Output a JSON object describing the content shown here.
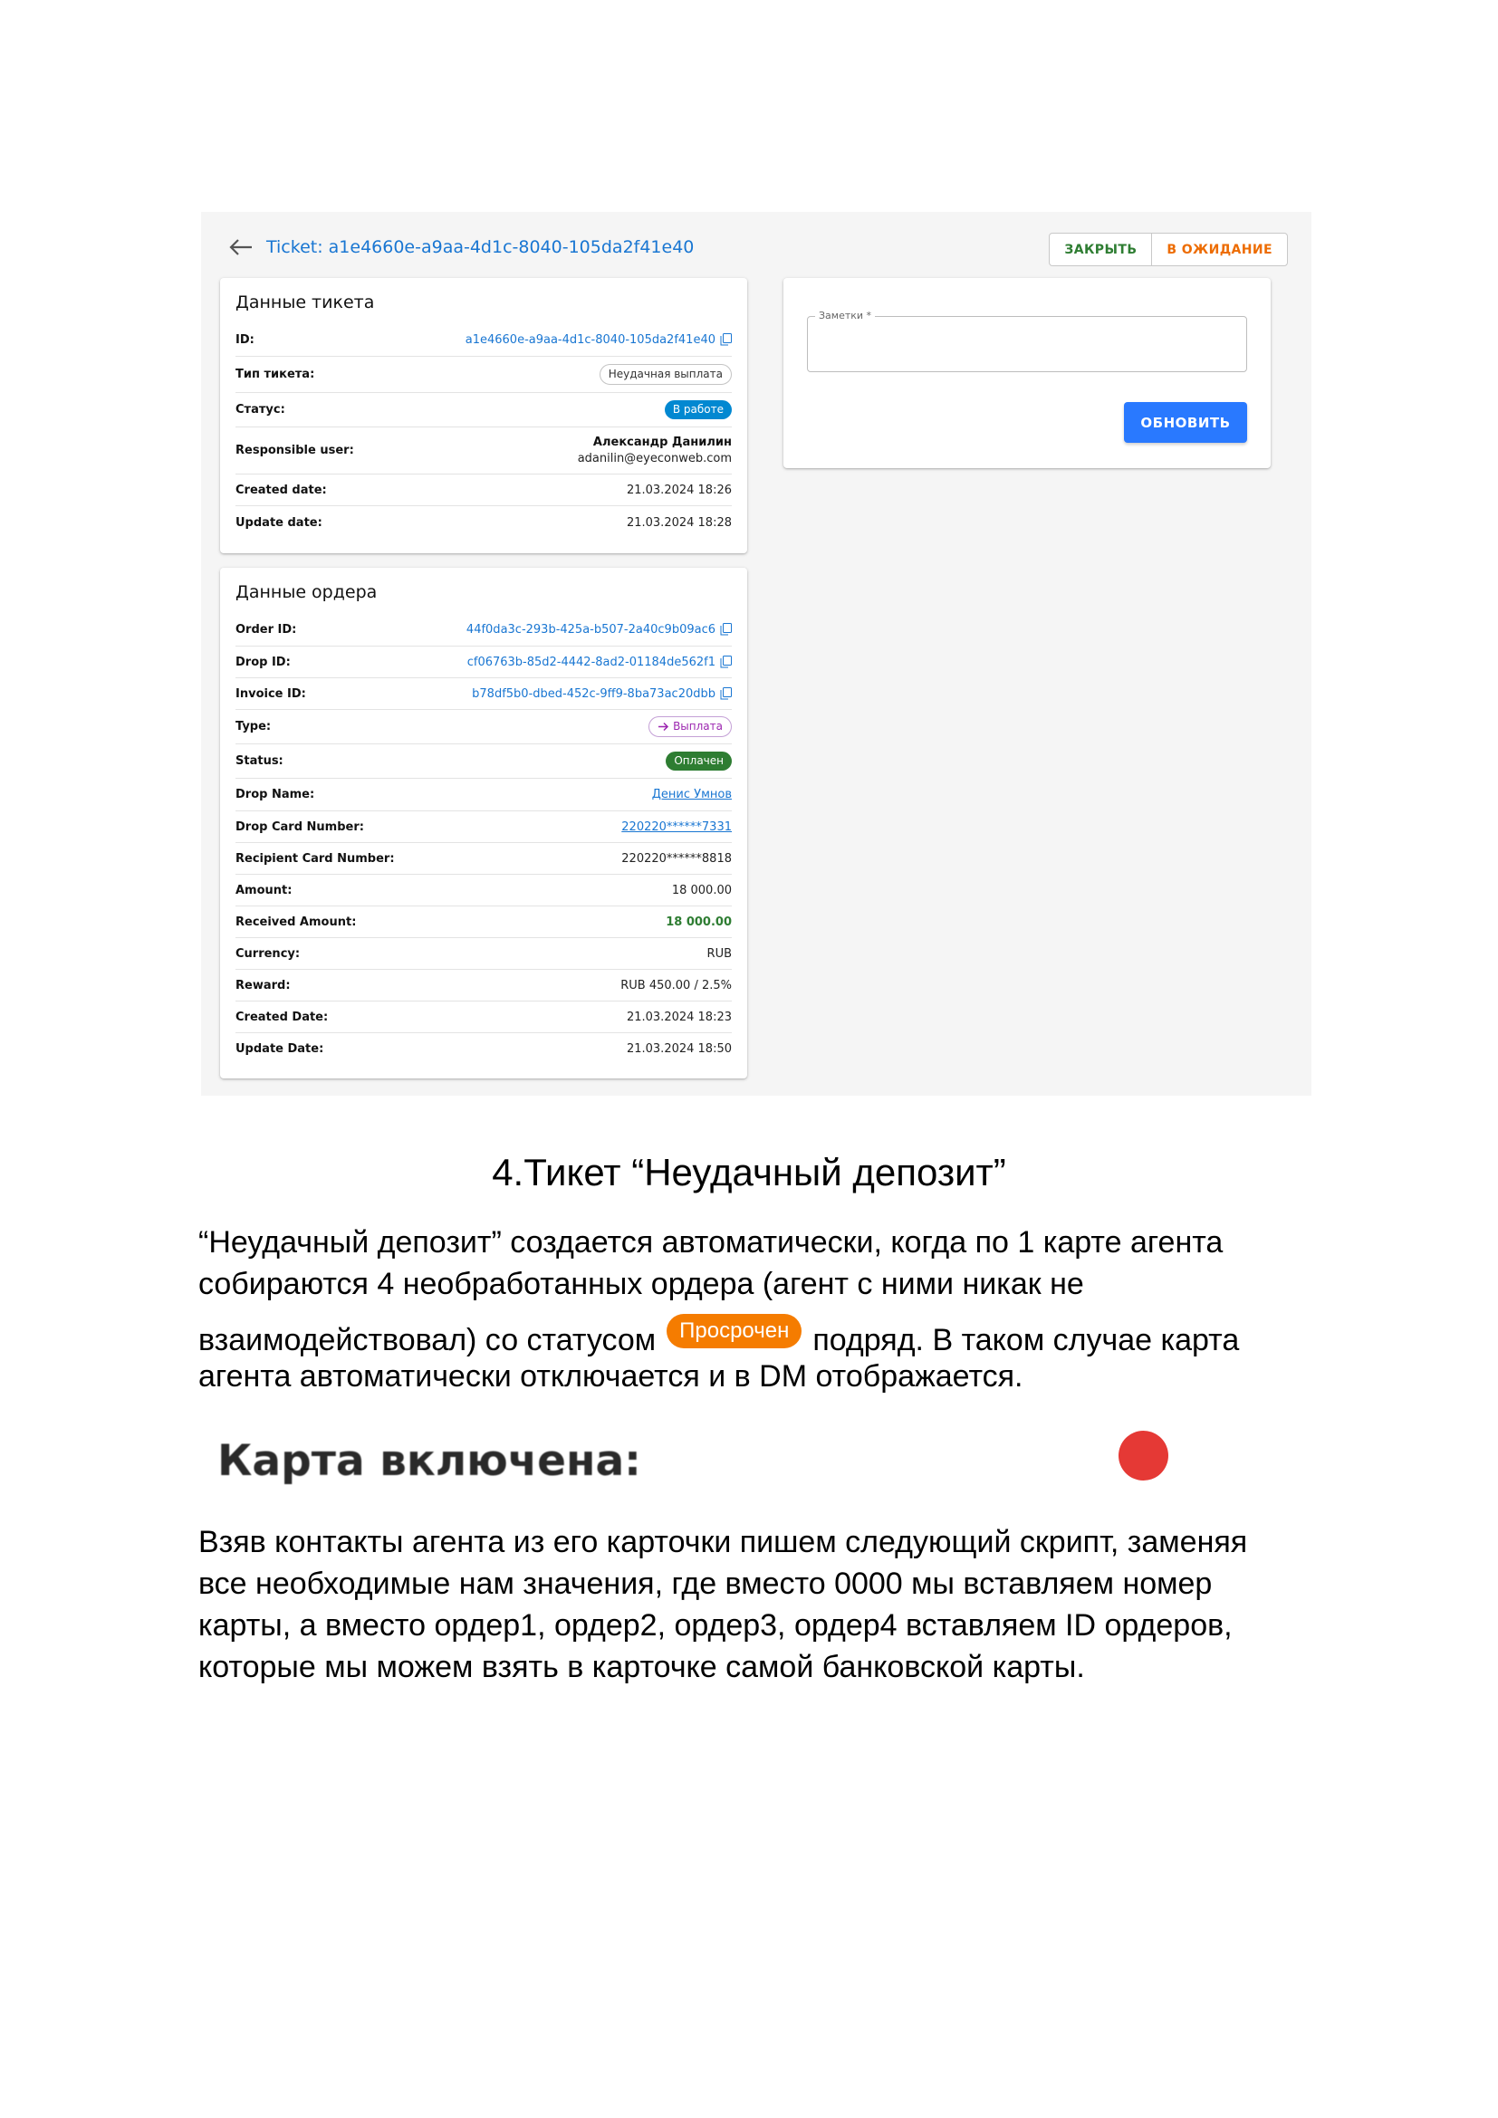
{
  "screenshot": {
    "ticket_title": "Ticket: a1e4660e-a9aa-4d1c-8040-105da2f41e40",
    "buttons": {
      "close": "ЗАКРЫТЬ",
      "waiting": "В ОЖИДАНИЕ"
    },
    "ticket_card": {
      "title": "Данные тикета",
      "rows": [
        {
          "key": "ID:",
          "value": "a1e4660e-a9aa-4d1c-8040-105da2f41e40"
        },
        {
          "key": "Тип тикета:",
          "value": "Неудачная выплата"
        },
        {
          "key": "Статус:",
          "value": "В работе"
        },
        {
          "key": "Responsible user:",
          "name": "Александр Данилин",
          "email": "adanilin@eyeconweb.com"
        },
        {
          "key": "Created date:",
          "value": "21.03.2024 18:26"
        },
        {
          "key": "Update date:",
          "value": "21.03.2024 18:28"
        }
      ]
    },
    "order_card": {
      "title": "Данные ордера",
      "rows": [
        {
          "key": "Order ID:",
          "value": "44f0da3c-293b-425a-b507-2a40c9b09ac6"
        },
        {
          "key": "Drop ID:",
          "value": "cf06763b-85d2-4442-8ad2-01184de562f1"
        },
        {
          "key": "Invoice ID:",
          "value": "b78df5b0-dbed-452c-9ff9-8ba73ac20dbb"
        },
        {
          "key": "Type:",
          "value": "Выплата"
        },
        {
          "key": "Status:",
          "value": "Оплачен"
        },
        {
          "key": "Drop Name:",
          "value": "Денис Умнов"
        },
        {
          "key": "Drop Card Number:",
          "value": "220220******7331"
        },
        {
          "key": "Recipient Card Number:",
          "value": "220220******8818"
        },
        {
          "key": "Amount:",
          "value": "18 000.00"
        },
        {
          "key": "Received Amount:",
          "value": "18 000.00"
        },
        {
          "key": "Currency:",
          "value": "RUB"
        },
        {
          "key": "Reward:",
          "value": "RUB 450.00 / 2.5%"
        },
        {
          "key": "Created Date:",
          "value": "21.03.2024 18:23"
        },
        {
          "key": "Update Date:",
          "value": "21.03.2024 18:50"
        }
      ]
    },
    "notes": {
      "label": "Заметки *",
      "update_button": "ОБНОВИТЬ"
    }
  },
  "document": {
    "heading": "4.Тикет “Неудачный депозит”",
    "para1_lines": [
      "“Неудачный депозит” создается автоматически, когда по 1 карте агента",
      "собираются 4 необработанных ордера (агент с ними никак не"
    ],
    "para1_line3_before": "взаимодействовал) со статусом",
    "para1_badge": "Просрочен",
    "para1_line3_after": "подряд. В таком случае карта",
    "para1_line4": "агента автоматически отключается и в DM отображается.",
    "card_enabled_label": "Карта включена:",
    "status_dot_color": "#e53935",
    "para2_lines": [
      "Взяв контакты агента из его карточки пишем следующий скрипт, заменяя",
      "все необходимые нам значения, где вместо 0000 мы вставляем номер",
      "карты, а вместо ордер1, ордер2, ордер3, ордер4 вставляем ID ордеров,",
      "которые мы можем взять в карточке самой банковской карты."
    ]
  }
}
